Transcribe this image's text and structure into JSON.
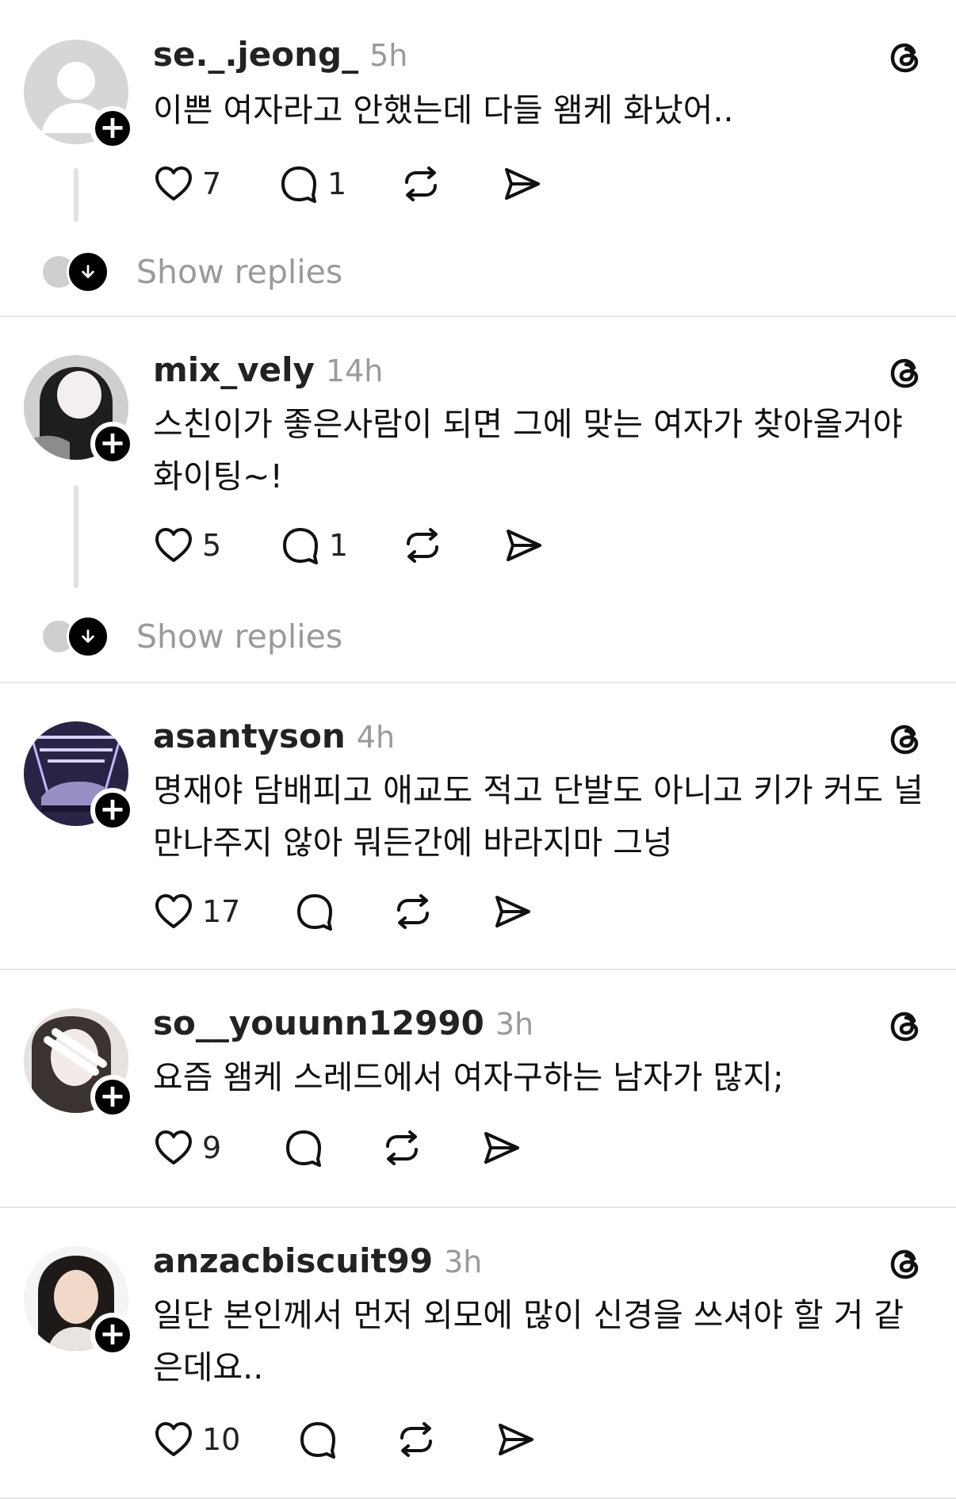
{
  "posts": [
    {
      "username": "se._.jeong_",
      "time": "5h",
      "text": "이쁜 여자라고 안했는데 다들 왬케 화났어..",
      "likes": "7",
      "comments": "1",
      "show_replies": "Show replies",
      "avatar_icon": "default-person-avatar"
    },
    {
      "username": "mix_vely",
      "time": "14h",
      "text": "스친이가 좋은사람이 되면 그에 맞는 여자가 찾아올거야 화이팅~!",
      "likes": "5",
      "comments": "1",
      "show_replies": "Show replies",
      "avatar_icon": "photo-avatar"
    },
    {
      "username": "asantyson",
      "time": "4h",
      "text": "명재야 담배피고 애교도 적고 단발도 아니고 키가 커도 널 만나주지 않아 뭐든간에 바라지마 그넝",
      "likes": "17",
      "comments": "",
      "avatar_icon": "car-photo-avatar"
    },
    {
      "username": "so__youunn12990",
      "time": "3h",
      "text": "요즘 왬케 스레드에서 여자구하는 남자가 많지;",
      "likes": "9",
      "comments": "",
      "avatar_icon": "photo-avatar"
    },
    {
      "username": "anzacbiscuit99",
      "time": "3h",
      "text": "일단 본인께서 먼저 외모에 많이 신경을 쓰셔야 할 거 같은데요..",
      "likes": "10",
      "comments": "",
      "avatar_icon": "portrait-avatar"
    }
  ],
  "icons": {
    "like": "heart-icon",
    "comment": "comment-icon",
    "repost": "repost-icon",
    "share": "send-icon",
    "threads": "threads-logo-icon",
    "follow": "plus-icon",
    "expand": "arrow-down-icon"
  },
  "colors": {
    "text": "#111111",
    "secondary": "#9a9a9a",
    "divider": "#e6e6e6",
    "badge": "#000000"
  }
}
